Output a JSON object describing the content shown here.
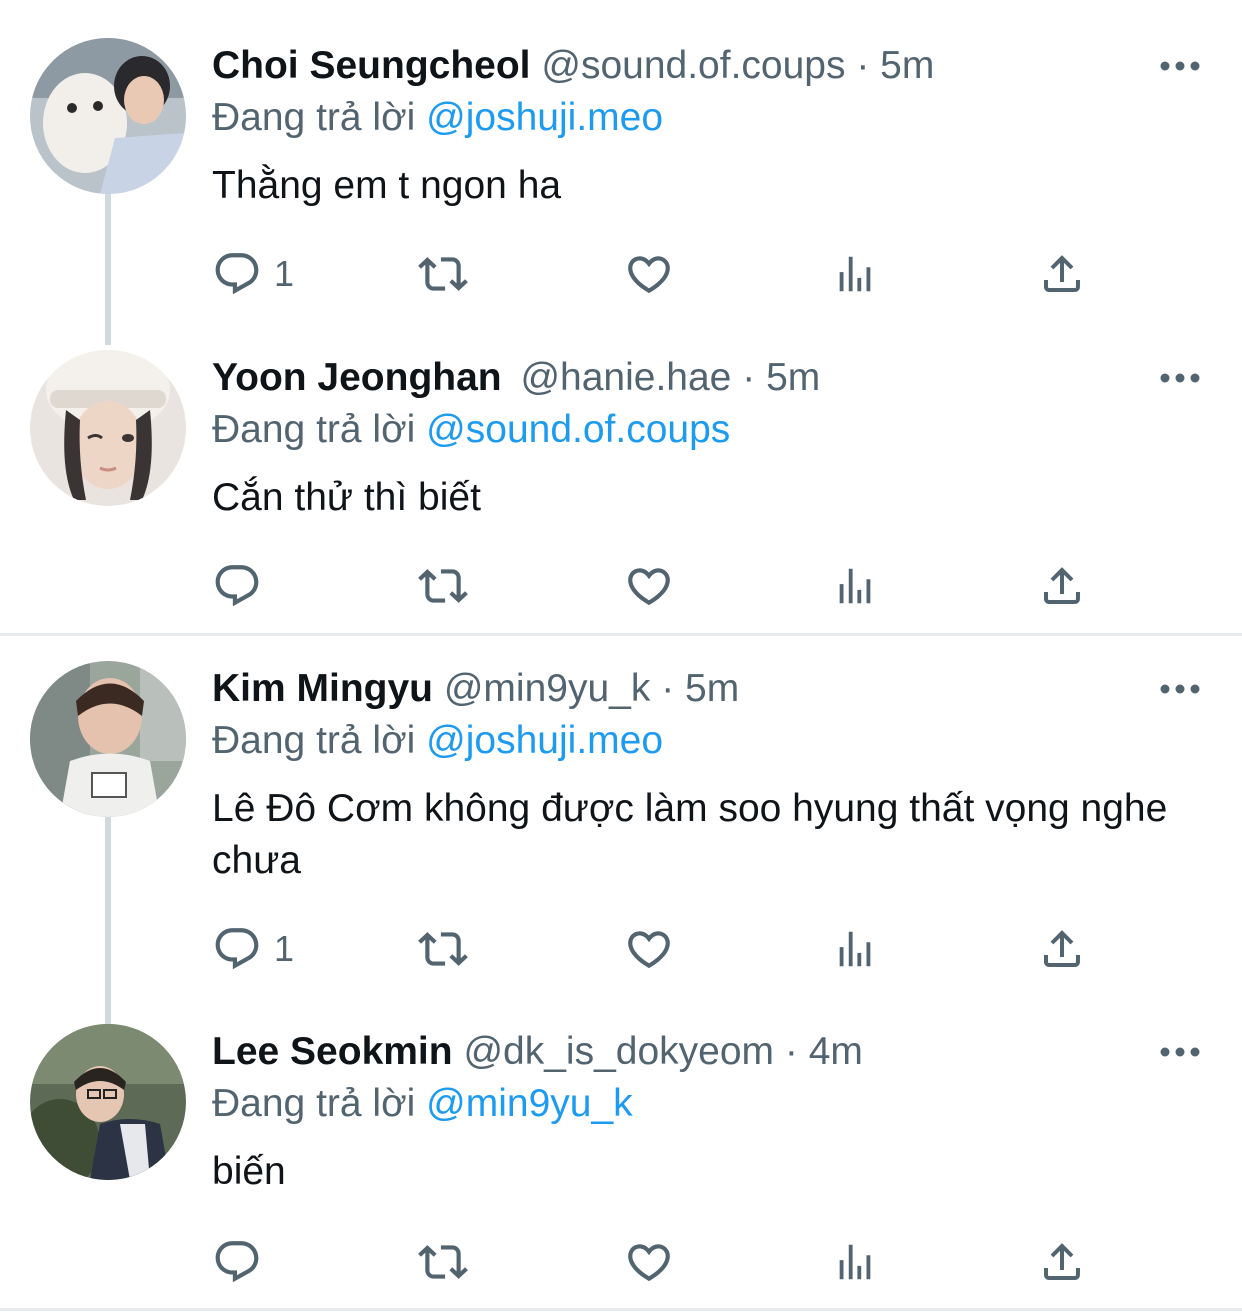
{
  "reply_prefix": "Đang trả lời",
  "separator": "·",
  "tweets": [
    {
      "name": "Choi Seungcheol",
      "handle": "@sound.of.coups",
      "time": "5m",
      "replying_to": "@joshuji.meo",
      "text": "Thằng em t ngon ha",
      "reply_count": "1"
    },
    {
      "name": "Yoon Jeonghan",
      "handle": "@hanie.hae",
      "time": "5m",
      "replying_to": "@sound.of.coups",
      "text": "Cắn thử thì biết",
      "reply_count": ""
    },
    {
      "name": "Kim Mingyu",
      "handle": "@min9yu_k",
      "time": "5m",
      "replying_to": "@joshuji.meo",
      "text": "Lê Đô Cơm không được làm soo hyung thất vọng nghe chưa",
      "reply_count": "1"
    },
    {
      "name": "Lee Seokmin",
      "handle": "@dk_is_dokyeom",
      "time": "4m",
      "replying_to": "@min9yu_k",
      "text": "biến",
      "reply_count": ""
    }
  ],
  "icons": {
    "reply": "reply-icon",
    "retweet": "retweet-icon",
    "like": "heart-icon",
    "views": "views-chart-icon",
    "share": "share-icon",
    "more": "more-dots-icon"
  },
  "colors": {
    "text": "#0f1419",
    "secondary": "#536471",
    "mention": "#1d9bf0",
    "thread_line": "#cfd9de",
    "divider": "#e6ebee"
  }
}
